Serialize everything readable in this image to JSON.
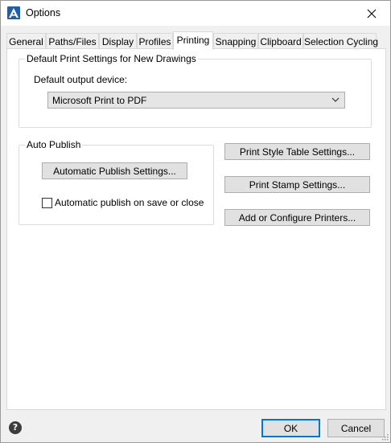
{
  "window": {
    "title": "Options"
  },
  "tabs": [
    {
      "label": "General"
    },
    {
      "label": "Paths/Files"
    },
    {
      "label": "Display"
    },
    {
      "label": "Profiles"
    },
    {
      "label": "Printing",
      "active": true
    },
    {
      "label": "Snapping"
    },
    {
      "label": "Clipboard"
    },
    {
      "label": "Selection Cycling"
    }
  ],
  "default_print": {
    "group_title": "Default Print Settings for New Drawings",
    "device_label": "Default output device:",
    "device_value": "Microsoft Print to PDF"
  },
  "auto_publish": {
    "group_title": "Auto Publish",
    "settings_button": "Automatic Publish Settings...",
    "checkbox_label": "Automatic publish on save or close",
    "checkbox_checked": false
  },
  "side_buttons": {
    "print_style": "Print Style Table Settings...",
    "print_stamp": "Print Stamp Settings...",
    "printers": "Add or Configure Printers..."
  },
  "footer": {
    "ok": "OK",
    "cancel": "Cancel"
  },
  "colors": {
    "accent": "#0078d7",
    "app_icon": "#1f5fa8"
  }
}
